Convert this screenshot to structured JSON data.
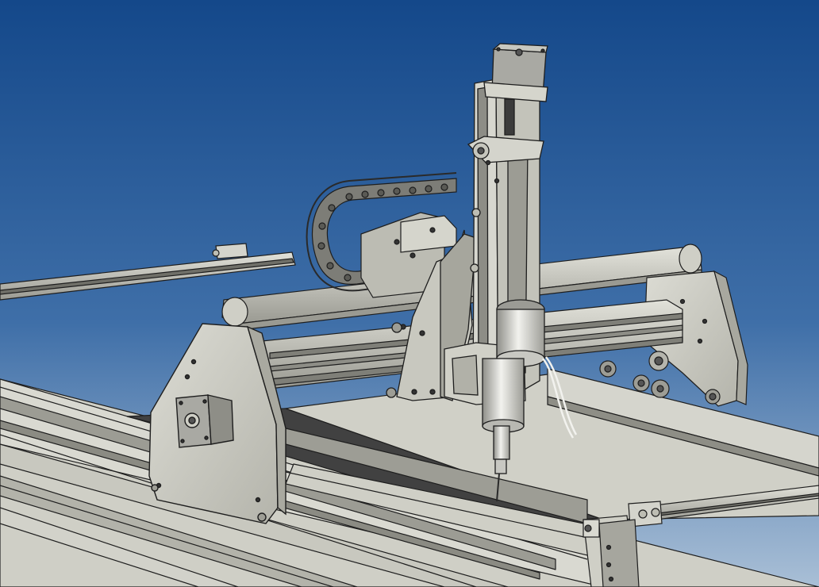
{
  "viewport": {
    "background_top": "#14488a",
    "background_bottom": "#a9bfd6"
  },
  "palette": {
    "metal_light": "#d7d7cf",
    "metal_mid": "#bdbdb3",
    "metal_dark": "#8f8f86",
    "edge": "#1e1e1e",
    "bed_dark": "#414141",
    "chain": "#7d7d77",
    "motor": "#a9a9a3",
    "spindle": "#dcdcd7"
  },
  "icons": [
    "cnc-router-model"
  ]
}
